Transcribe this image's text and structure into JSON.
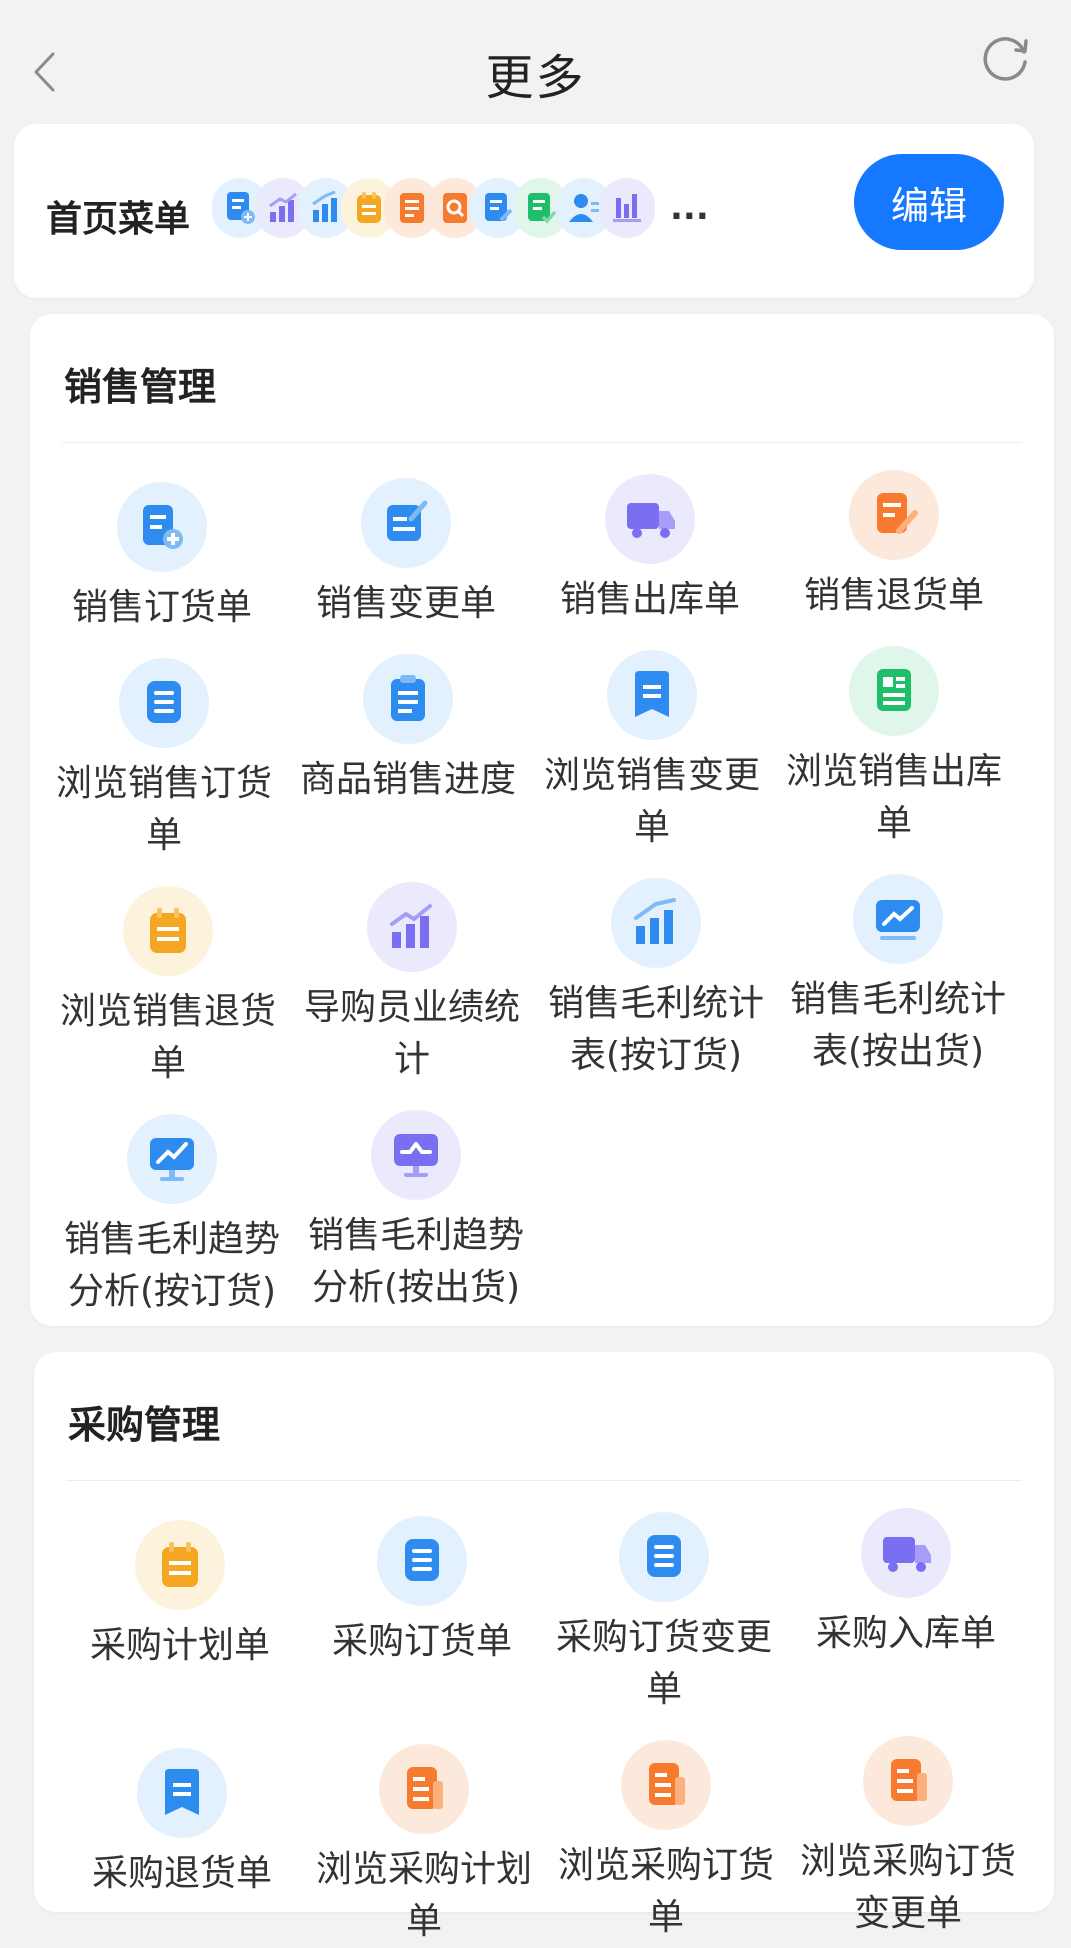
{
  "header": {
    "title": "更多",
    "back_icon": "chevron-left-icon",
    "refresh_icon": "refresh-icon"
  },
  "home_menu": {
    "label": "首页菜单",
    "more": "...",
    "edit_label": "编辑",
    "icons": [
      "doc-add-icon",
      "bar-chart-up-icon",
      "bar-chart-icon",
      "clipboard-icon",
      "list-doc-icon",
      "search-doc-icon",
      "doc-edit-icon",
      "doc-check-icon",
      "user-icon",
      "bar-stats-icon"
    ]
  },
  "sales": {
    "title": "销售管理",
    "items": [
      {
        "label": "销售订货单",
        "icon": "order-add-icon"
      },
      {
        "label": "销售变更单",
        "icon": "edit-doc-icon"
      },
      {
        "label": "销售出库单",
        "icon": "truck-icon"
      },
      {
        "label": "销售退货单",
        "icon": "return-doc-icon"
      },
      {
        "label": "浏览销售订货单",
        "icon": "list-icon"
      },
      {
        "label": "商品销售进度",
        "icon": "clipboard-icon"
      },
      {
        "label": "浏览销售变更单",
        "icon": "bookmark-icon"
      },
      {
        "label": "浏览销售出库单",
        "icon": "receipt-icon"
      },
      {
        "label": "浏览销售退货单",
        "icon": "notepad-icon"
      },
      {
        "label": "导购员业绩统计",
        "icon": "bar-chart-up-icon"
      },
      {
        "label": "销售毛利统计表(按订货)",
        "icon": "bar-chart-icon"
      },
      {
        "label": "销售毛利统计表(按出货)",
        "icon": "trend-card-icon"
      },
      {
        "label": "销售毛利趋势分析(按订货)",
        "icon": "monitor-trend-icon"
      },
      {
        "label": "销售毛利趋势分析(按出货)",
        "icon": "monitor-wave-icon"
      }
    ]
  },
  "purchase": {
    "title": "采购管理",
    "items": [
      {
        "label": "采购计划单",
        "icon": "notepad-icon"
      },
      {
        "label": "采购订货单",
        "icon": "list-icon"
      },
      {
        "label": "采购订货变更单",
        "icon": "list-icon"
      },
      {
        "label": "采购入库单",
        "icon": "truck-icon"
      },
      {
        "label": "采购退货单",
        "icon": "bookmark-icon"
      },
      {
        "label": "浏览采购计划单",
        "icon": "report-doc-icon"
      },
      {
        "label": "浏览采购订货单",
        "icon": "report-doc-icon"
      },
      {
        "label": "浏览采购订货变更单",
        "icon": "report-doc-icon"
      }
    ]
  },
  "colors": {
    "accent": "#1677ff",
    "blue": "#2e8cf0",
    "orange": "#f77b2f",
    "yellow": "#f5a623",
    "purple": "#7a6ff0",
    "green": "#1fbf6a"
  }
}
